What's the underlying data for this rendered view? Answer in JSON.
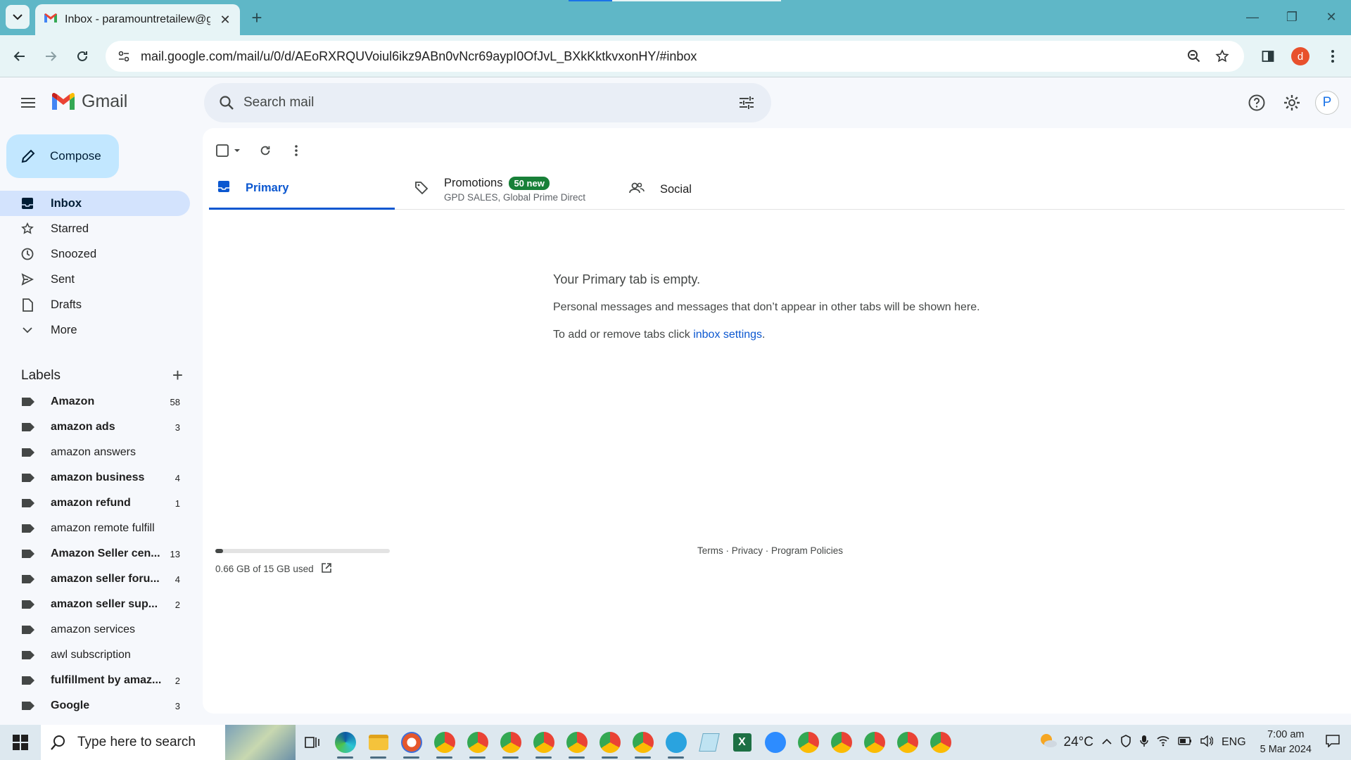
{
  "browser": {
    "tab_title": "Inbox - paramountretailew@gm",
    "url": "mail.google.com/mail/u/0/d/AEoRXRQUVoiul6ikz9ABn0vNcr69aypI0OfJvL_BXkKktkvxonHY/#inbox",
    "profile_initial": "d"
  },
  "header": {
    "app_name": "Gmail",
    "search_placeholder": "Search mail",
    "account_initial": "P"
  },
  "sidebar": {
    "compose_label": "Compose",
    "nav": [
      {
        "label": "Inbox",
        "icon": "inbox-icon",
        "active": true
      },
      {
        "label": "Starred",
        "icon": "star-icon"
      },
      {
        "label": "Snoozed",
        "icon": "clock-icon"
      },
      {
        "label": "Sent",
        "icon": "send-icon"
      },
      {
        "label": "Drafts",
        "icon": "draft-icon"
      },
      {
        "label": "More",
        "icon": "chevron-down-icon"
      }
    ],
    "labels_title": "Labels",
    "labels": [
      {
        "name": "Amazon",
        "count": "58",
        "bold": true
      },
      {
        "name": "amazon ads",
        "count": "3",
        "bold": true
      },
      {
        "name": "amazon answers",
        "count": "",
        "bold": false
      },
      {
        "name": "amazon business",
        "count": "4",
        "bold": true
      },
      {
        "name": "amazon refund",
        "count": "1",
        "bold": true
      },
      {
        "name": "amazon remote fulfill",
        "count": "",
        "bold": false
      },
      {
        "name": "Amazon Seller cen...",
        "count": "13",
        "bold": true
      },
      {
        "name": "amazon seller foru...",
        "count": "4",
        "bold": true
      },
      {
        "name": "amazon seller sup...",
        "count": "2",
        "bold": true
      },
      {
        "name": "amazon services",
        "count": "",
        "bold": false
      },
      {
        "name": "awl subscription",
        "count": "",
        "bold": false
      },
      {
        "name": "fulfillment by amaz...",
        "count": "2",
        "bold": true
      },
      {
        "name": "Google",
        "count": "3",
        "bold": true
      }
    ]
  },
  "tabs": {
    "primary": "Primary",
    "promotions": "Promotions",
    "promotions_badge": "50 new",
    "promotions_sub": "GPD SALES, Global Prime Direct",
    "social": "Social"
  },
  "empty_state": {
    "title": "Your Primary tab is empty.",
    "line1": "Personal messages and messages that don’t appear in other tabs will be shown here.",
    "line2_prefix": "To add or remove tabs click ",
    "line2_link": "inbox settings",
    "line2_suffix": "."
  },
  "storage": {
    "text": "0.66 GB of 15 GB used",
    "fraction": 0.044
  },
  "footer": {
    "terms": "Terms",
    "privacy": "Privacy",
    "policies": "Program Policies",
    "sep": " · "
  },
  "taskbar": {
    "search_placeholder": "Type here to search",
    "weather": "24°C",
    "lang": "ENG",
    "time": "7:00 am",
    "date": "5 Mar 2024"
  },
  "colors": {
    "accent": "#0b57d0",
    "compose_bg": "#c2e7ff",
    "active_nav": "#d3e3fd",
    "promo_badge": "#188038",
    "tabstrip": "#5fb7c7"
  }
}
